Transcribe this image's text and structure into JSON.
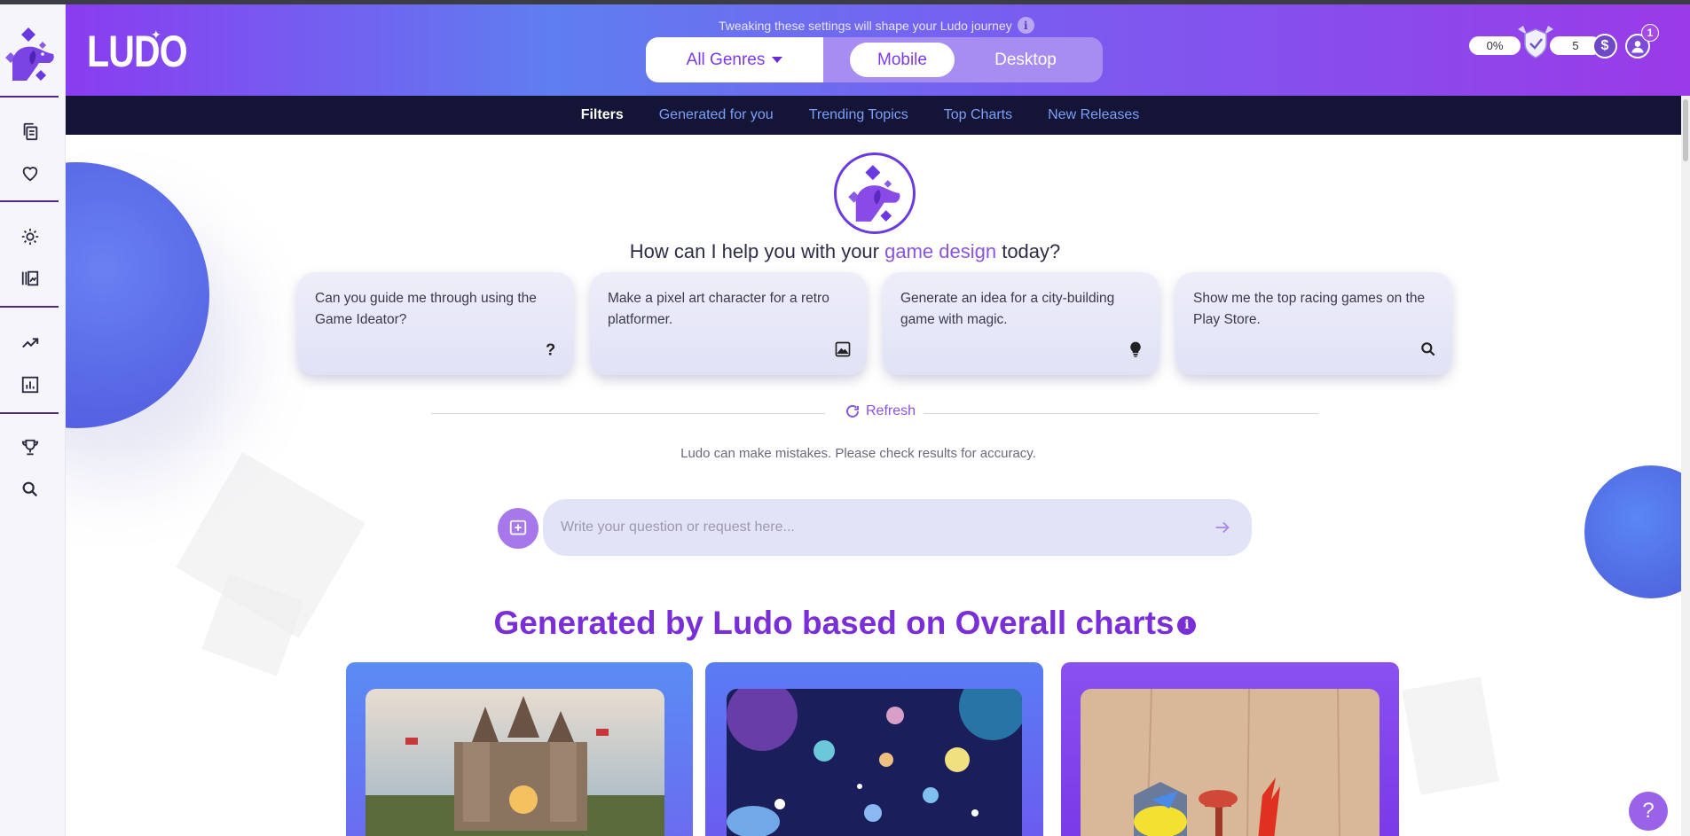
{
  "header": {
    "brand": "LUDO",
    "notice": "Tweaking these settings will shape your Ludo journey",
    "genre_selected": "All Genres",
    "platforms": [
      "Mobile",
      "Desktop"
    ],
    "progress_label": "0%",
    "coins": "5",
    "notifications": "1"
  },
  "nav": {
    "items": [
      "Filters",
      "Generated for you",
      "Trending Topics",
      "Top Charts",
      "New Releases"
    ],
    "active": "Filters"
  },
  "main": {
    "greeting_prefix": "How can I help you with your ",
    "greeting_highlight": "game design",
    "greeting_suffix": " today?",
    "suggestions": [
      {
        "text": "Can you guide me through using the Game Ideator?",
        "icon": "question-icon"
      },
      {
        "text": "Make a pixel art character for a retro platformer.",
        "icon": "image-icon"
      },
      {
        "text": "Generate an idea for a city-building game with magic.",
        "icon": "lightbulb-icon"
      },
      {
        "text": "Show me the top racing games on the Play Store.",
        "icon": "search-icon"
      }
    ],
    "refresh_label": "Refresh",
    "disclaimer": "Ludo can make mistakes. Please check results for accuracy.",
    "prompt_placeholder": "Write your question or request here...",
    "section_title": "Generated by Ludo based on Overall charts"
  },
  "sidebar": {
    "icons": [
      "copy-icon",
      "heart-icon",
      "lightbulb-icon",
      "library-icon",
      "trending-icon",
      "bar-chart-icon",
      "trophy-icon",
      "search-icon"
    ]
  },
  "colors": {
    "accent": "#7a2ed8",
    "nav_bg": "#141436",
    "nav_link": "#7aa0f8"
  }
}
